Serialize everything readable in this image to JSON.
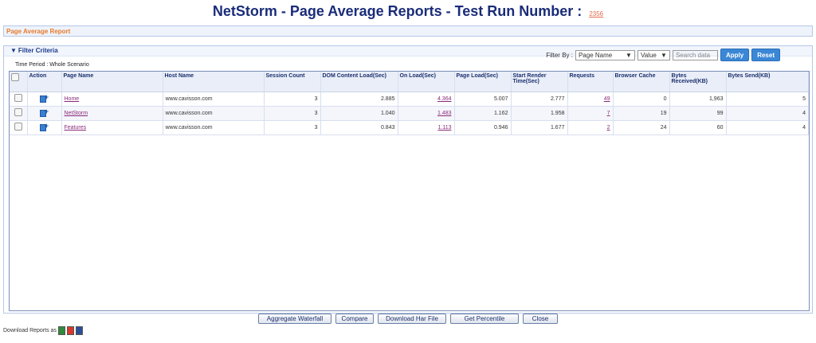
{
  "header": {
    "title": "NetStorm - Page Average Reports - Test Run Number :",
    "run_number": "2356"
  },
  "breadcrumb": {
    "label": "Page Average Report"
  },
  "filter": {
    "title": "Filter Criteria",
    "filter_by_label": "Filter By :",
    "field_select": "Page Name",
    "value_select": "Value",
    "search_placeholder": "Search data",
    "apply_label": "Apply",
    "reset_label": "Reset",
    "time_period": "Time Period : Whole Scenario"
  },
  "table": {
    "headers": [
      "Action",
      "Page Name",
      "Host Name",
      "Session Count",
      "DOM Content Load(Sec)",
      "On Load(Sec)",
      "Page Load(Sec)",
      "Start Render Time(Sec)",
      "Requests",
      "Browser Cache",
      "Bytes Received(KB)",
      "Bytes Send(KB)"
    ],
    "rows": [
      {
        "page": "Home",
        "host": "www.cavisson.com",
        "session": "3",
        "dom": "2.885",
        "onload": "4.364",
        "pageload": "5.007",
        "render": "2.777",
        "requests": "49",
        "cache": "0",
        "received": "1,963",
        "sent": "5"
      },
      {
        "page": "NetStorm",
        "host": "www.cavisson.com",
        "session": "3",
        "dom": "1.040",
        "onload": "1.483",
        "pageload": "1.162",
        "render": "1.958",
        "requests": "7",
        "cache": "19",
        "received": "99",
        "sent": "4"
      },
      {
        "page": "Features",
        "host": "www.cavisson.com",
        "session": "3",
        "dom": "0.843",
        "onload": "1.113",
        "pageload": "0.946",
        "render": "1.677",
        "requests": "2",
        "cache": "24",
        "received": "60",
        "sent": "4"
      }
    ]
  },
  "footer": {
    "buttons": [
      "Aggregate Waterfall",
      "Compare",
      "Download Har File",
      "Get Percentile",
      "Close"
    ],
    "download_label": "Download Reports as"
  },
  "colors": {
    "title": "#1a2c79",
    "accent_button": "#3a87d6",
    "link": "#8a2b7a",
    "breadcrumb": "#e87a2c"
  }
}
